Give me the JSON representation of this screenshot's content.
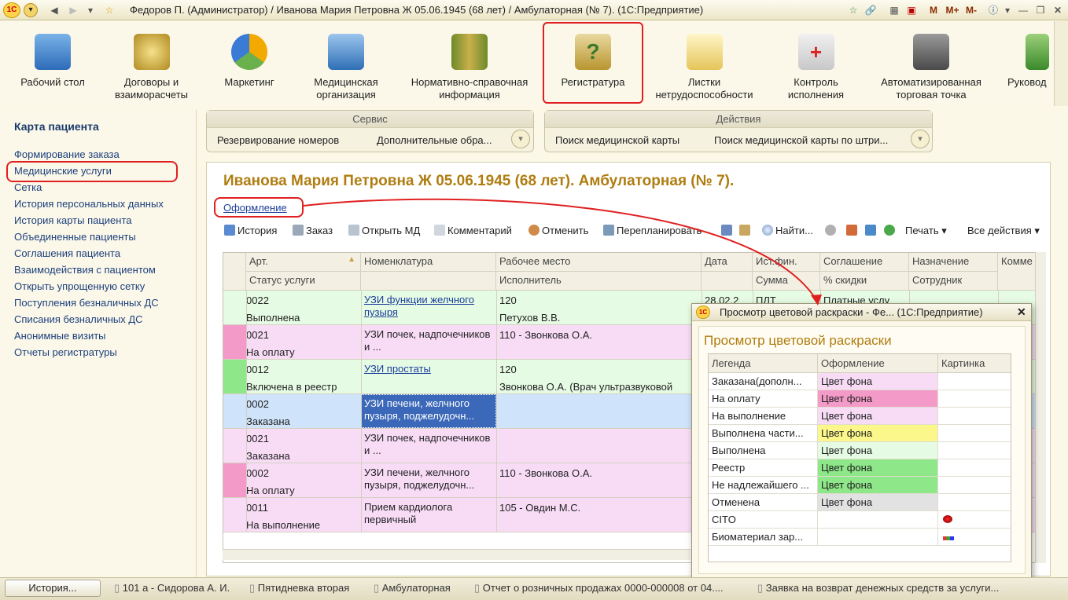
{
  "window": {
    "title": "Федоров П. (Администратор) / Иванова Мария Петровна Ж 05.06.1945 (68 лет) / Амбулаторная (№ 7).  (1С:Предприятие)",
    "tools": [
      "M",
      "M+",
      "M-"
    ]
  },
  "sections": [
    {
      "label": "Рабочий стол",
      "icon": "desk-icon"
    },
    {
      "label": "Договоры и взаиморасчеты",
      "icon": "coins-icon"
    },
    {
      "label": "Маркетинг",
      "icon": "pie-chart-icon"
    },
    {
      "label": "Медицинская организация",
      "icon": "building-icon"
    },
    {
      "label": "Нормативно-справочная информация",
      "icon": "binders-icon"
    },
    {
      "label": "Регистратура",
      "icon": "clipboard-question-icon"
    },
    {
      "label": "Листки нетрудоспособности",
      "icon": "sick-leave-icon"
    },
    {
      "label": "Контроль исполнения",
      "icon": "control-icon"
    },
    {
      "label": "Автоматизированная торговая точка",
      "icon": "cash-register-icon"
    },
    {
      "label": "Руковод",
      "icon": "manager-icon"
    }
  ],
  "left_panel": {
    "title": "Карта пациента",
    "items": [
      "Формирование заказа",
      "Медицинские услуги",
      "Сетка",
      "История персональных данных",
      "История карты пациента",
      "Объединенные пациенты",
      "Соглашения пациента",
      "Взаимодействия с пациентом",
      "Открыть упрощенную сетку",
      "Поступления безналичных ДС",
      "Списания безналичных ДС",
      "Анонимные визиты",
      "Отчеты регистратуры"
    ]
  },
  "service_panel": {
    "title": "Сервис",
    "items": [
      "Резервирование номеров",
      "Дополнительные обра..."
    ]
  },
  "actions_panel": {
    "title": "Действия",
    "items": [
      "Поиск медицинской карты",
      "Поиск медицинской карты по штри..."
    ]
  },
  "document": {
    "title": "Иванова Мария Петровна Ж 05.06.1945 (68 лет). Амбулаторная (№ 7).",
    "link": "Оформление"
  },
  "toolbar": {
    "history": "История",
    "order": "Заказ",
    "open_md": "Открыть МД",
    "comment": "Комментарий",
    "cancel": "Отменить",
    "reschedule": "Перепланировать",
    "find": "Найти...",
    "print": "Печать",
    "all_actions": "Все действия"
  },
  "grid": {
    "headers_top": [
      "Арт.",
      "Номенклатура",
      "Рабочее место",
      "Дата",
      "Ист.фин.",
      "Соглашение",
      "Назначение",
      "Комме"
    ],
    "headers_bottom": [
      "Статус услуги",
      "",
      "Исполнитель",
      "",
      "Сумма",
      "% скидки",
      "Сотрудник",
      ""
    ],
    "rows": [
      {
        "art": "0022",
        "status": "Выполнена",
        "nom": "УЗИ функции желчного пузыря",
        "nom_link": true,
        "place": "120",
        "exec": "Петухов В.В.",
        "date": "28.02.2",
        "src": "ПЛТ",
        "agr": "Платные услу",
        "bg": "#e6fbe4",
        "marker": "#e6fbe4"
      },
      {
        "art": "0021",
        "status": "На оплату",
        "nom": "УЗИ почек, надпочечников и ...",
        "nom_link": false,
        "place": "110 - Звонкова О.А.",
        "exec": "",
        "date": "",
        "src": "",
        "agr": "",
        "bg": "#f8dcf6",
        "marker": "#f49ac8"
      },
      {
        "art": "0012",
        "status": "Включена в реестр",
        "nom": "УЗИ простаты",
        "nom_link": true,
        "place": "120",
        "exec": "Звонкова О.А. (Врач ультразвуковой",
        "date": "",
        "src": "",
        "agr": "",
        "bg": "#e6fbe4",
        "marker": "#8ee889"
      },
      {
        "art": "0002",
        "status": "Заказана",
        "nom": "УЗИ печени, желчного пузыря, поджелудочн...",
        "nom_link": false,
        "place": "",
        "exec": "",
        "date": "",
        "src": "",
        "agr": "",
        "bg": "#cfe3fa",
        "marker": "#cfe3fa",
        "selected": true
      },
      {
        "art": "0021",
        "status": "Заказана",
        "nom": "УЗИ почек, надпочечников и ...",
        "nom_link": false,
        "place": "",
        "exec": "",
        "date": "",
        "src": "",
        "agr": "",
        "bg": "#f8dcf6",
        "marker": "#f8dcf6"
      },
      {
        "art": "0002",
        "status": "На оплату",
        "nom": "УЗИ печени, желчного пузыря, поджелудочн...",
        "nom_link": false,
        "place": "110 - Звонкова О.А.",
        "exec": "",
        "date": "",
        "src": "",
        "agr": "",
        "bg": "#f8dcf6",
        "marker": "#f49ac8"
      },
      {
        "art": "0011",
        "status": "На выполнение",
        "nom": "Прием кардиолога первичный",
        "nom_link": false,
        "place": "105 - Овдин М.С.",
        "exec": "",
        "date": "",
        "src": "",
        "agr": "",
        "bg": "#f8dcf6",
        "marker": "#f8dcf6"
      }
    ]
  },
  "popup": {
    "window_title": "Просмотр цветовой раскраски - Фе...  (1С:Предприятие)",
    "heading": "Просмотр цветовой раскраски",
    "columns": [
      "Легенда",
      "Оформление",
      "Картинка"
    ],
    "rows": [
      {
        "legend": "Заказана(дополн...",
        "style": "Цвет фона",
        "color": "#f8dcf6",
        "pic": ""
      },
      {
        "legend": "На оплату",
        "style": "Цвет фона",
        "color": "#f49ac8",
        "pic": ""
      },
      {
        "legend": "На выполнение",
        "style": "Цвет фона",
        "color": "#f8dcf6",
        "pic": ""
      },
      {
        "legend": "Выполнена части...",
        "style": "Цвет фона",
        "color": "#fbf78a",
        "pic": ""
      },
      {
        "legend": "Выполнена",
        "style": "Цвет фона",
        "color": "#e6fbe4",
        "pic": ""
      },
      {
        "legend": "Реестр",
        "style": "Цвет фона",
        "color": "#8ee889",
        "pic": ""
      },
      {
        "legend": "Не надлежайшего ...",
        "style": "Цвет фона",
        "color": "#8ee889",
        "pic": ""
      },
      {
        "legend": "Отменена",
        "style": "Цвет фона",
        "color": "#e2e2e2",
        "pic": ""
      },
      {
        "legend": "CITO",
        "style": "",
        "color": "",
        "pic": "cito-icon"
      },
      {
        "legend": "Биоматериал зар...",
        "style": "",
        "color": "",
        "pic": "biomaterial-icon"
      }
    ]
  },
  "statusbar": {
    "history_button": "История...",
    "items": [
      "101 а - Сидорова А. И.",
      "Пятидневка вторая",
      "Амбулаторная",
      "Отчет о розничных продажах 0000-000008 от 04....",
      "Заявка на возврат денежных средств за услуги..."
    ]
  }
}
